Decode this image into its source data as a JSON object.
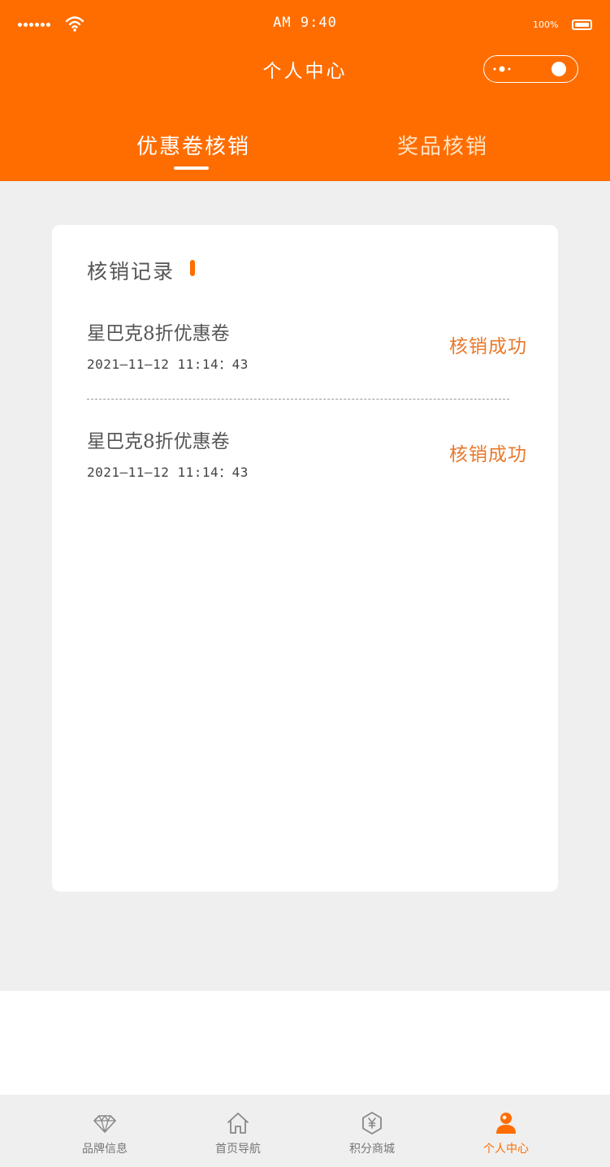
{
  "status_bar": {
    "time": "AM 9:40",
    "battery": "100%"
  },
  "header": {
    "title": "个人中心"
  },
  "tabs": [
    {
      "label": "优惠卷核销",
      "active": true
    },
    {
      "label": "奖品核销",
      "active": false
    }
  ],
  "card": {
    "title": "核销记录",
    "records": [
      {
        "name": "星巴克8折优惠卷",
        "time": "2021—11—12 11:14：43",
        "status": "核销成功"
      },
      {
        "name": "星巴克8折优惠卷",
        "time": "2021—11—12 11:14：43",
        "status": "核销成功"
      }
    ]
  },
  "tabbar": {
    "items": [
      {
        "label": "品牌信息",
        "icon": "diamond-icon"
      },
      {
        "label": "首页导航",
        "icon": "home-icon"
      },
      {
        "label": "积分商城",
        "icon": "yen-hexagon-icon"
      },
      {
        "label": "个人中心",
        "icon": "user-icon",
        "active": true
      }
    ]
  },
  "colors": {
    "brand": "#ff6d00",
    "status_success": "#e9782a",
    "background": "#efefef"
  }
}
